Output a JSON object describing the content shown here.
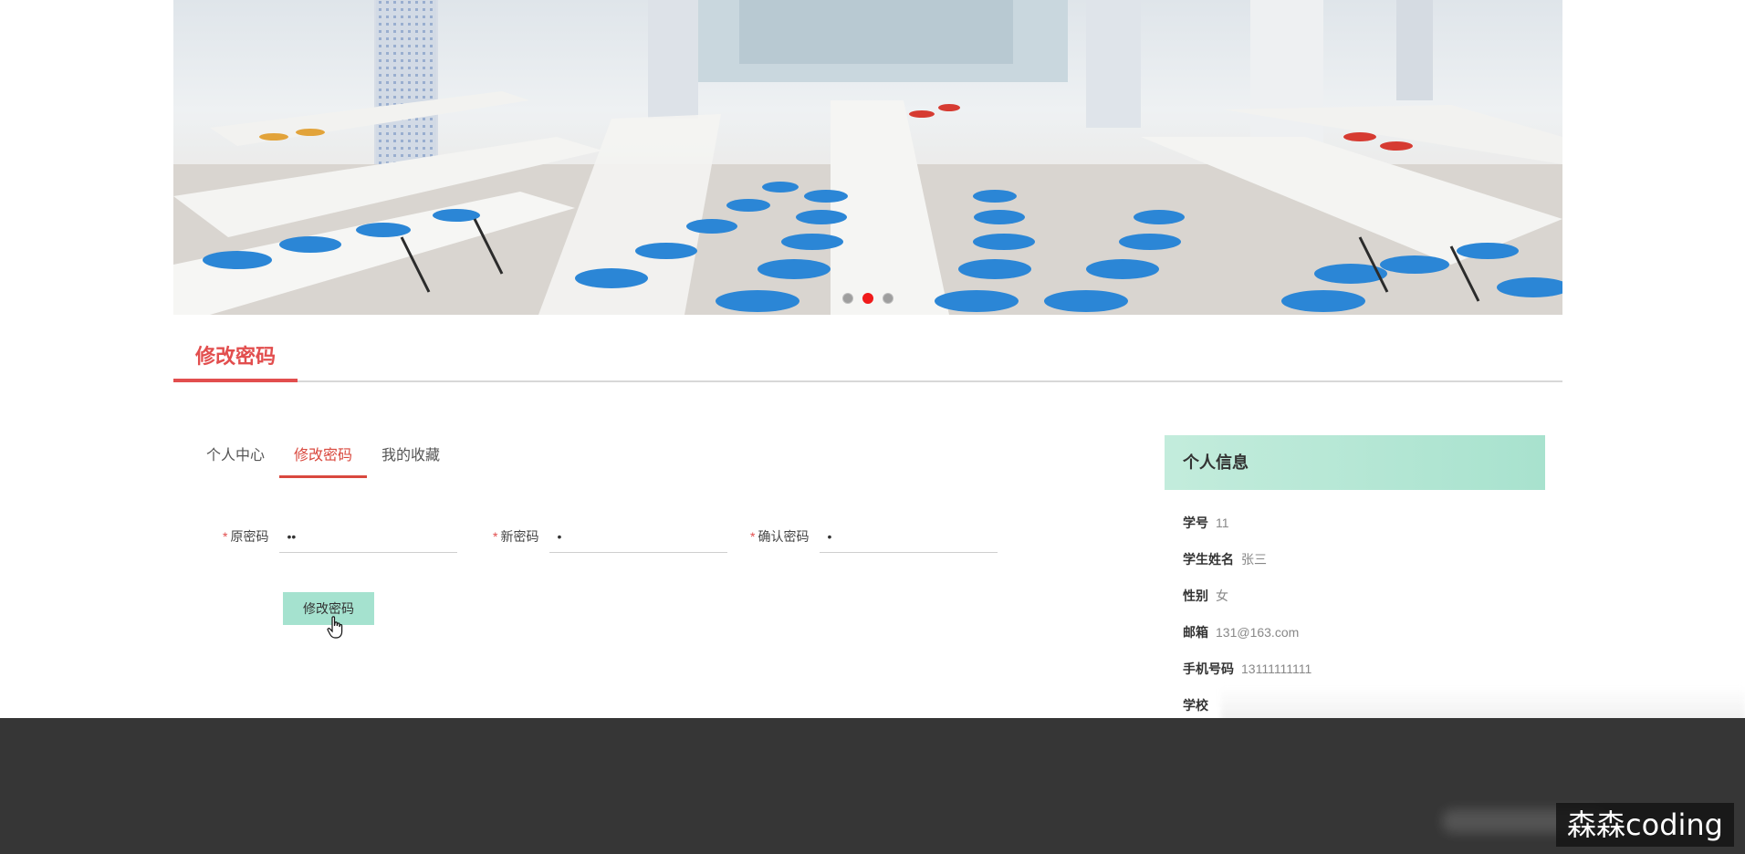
{
  "banner": {
    "slide_count": 3,
    "active_slide": 2
  },
  "page_title": "修改密码",
  "tabs": [
    {
      "label": "个人中心",
      "active": false
    },
    {
      "label": "修改密码",
      "active": true
    },
    {
      "label": "我的收藏",
      "active": false
    }
  ],
  "form": {
    "old_password": {
      "label": "原密码",
      "value": "••"
    },
    "new_password": {
      "label": "新密码",
      "value": "•"
    },
    "confirm_password": {
      "label": "确认密码",
      "value": "•"
    },
    "submit_label": "修改密码"
  },
  "info": {
    "title": "个人信息",
    "items": [
      {
        "key": "学号",
        "value": "11"
      },
      {
        "key": "学生姓名",
        "value": "张三"
      },
      {
        "key": "性别",
        "value": "女"
      },
      {
        "key": "邮箱",
        "value": "131@163.com"
      },
      {
        "key": "手机号码",
        "value": "13111111111"
      },
      {
        "key": "学校",
        "value": ""
      }
    ]
  },
  "watermark": "森森coding",
  "colors": {
    "accent": "#e24e4e",
    "button": "#a5e2cf",
    "footer": "#363636",
    "card_header": "#b6e7d5"
  }
}
